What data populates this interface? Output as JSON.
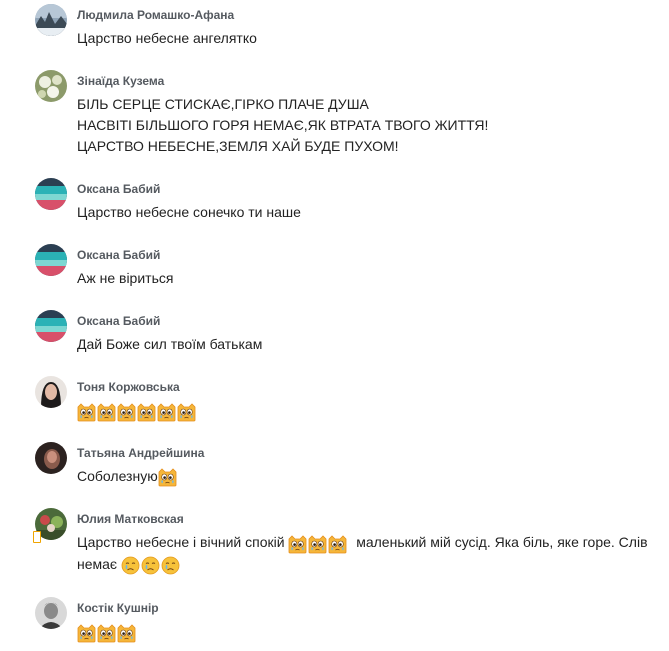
{
  "comments": [
    {
      "author": "Людмила Ромашко-Афана",
      "avatar_icon": "winter-landscape-avatar",
      "lines": [
        "Царство небесне ангелятко"
      ]
    },
    {
      "author": "Зінаїда Кузема",
      "avatar_icon": "flowers-avatar",
      "lines": [
        "БІЛЬ СЕРЦЕ СТИСКАЄ,ГІРКО ПЛАЧЕ ДУША",
        "НАСВІТІ БІЛЬШОГО ГОРЯ НЕМАЄ,ЯК ВТРАТА ТВОГО ЖИТТЯ!",
        "ЦАРСТВО НЕБЕСНЕ,ЗЕМЛЯ ХАЙ БУДЕ ПУХОМ!"
      ]
    },
    {
      "author": "Оксана Бабий",
      "avatar_icon": "sea-sunset-avatar",
      "lines": [
        "Царство небесне сонечко ти наше"
      ]
    },
    {
      "author": "Оксана Бабий",
      "avatar_icon": "sea-sunset-avatar",
      "lines": [
        "Аж не віриться"
      ]
    },
    {
      "author": "Оксана Бабий",
      "avatar_icon": "sea-sunset-avatar",
      "lines": [
        "Дай Боже сил твоїм батькам"
      ]
    },
    {
      "author": "Тоня Коржовська",
      "avatar_icon": "portrait-avatar",
      "emoji": "crying-cat-emoji",
      "emoji_count": 6
    },
    {
      "author": "Татьяна Андрейшина",
      "avatar_icon": "dark-portrait-avatar",
      "text_before_emoji": "Соболезную",
      "emoji": "crying-cat-emoji",
      "emoji_count": 1
    },
    {
      "author": "Юлия Матковская",
      "avatar_icon": "garden-avatar",
      "line1_start": "Царство небесне і вічний спокій",
      "line1_end": "маленький мій сусід. Яка біль, яке горе.  Слів",
      "line1_emoji_count": 3,
      "line2_start": "немає",
      "line2_emoji_count": 3,
      "line2_emoji": "crying-face-emoji",
      "mobile_icon": "mobile-phone-icon"
    },
    {
      "author": "Костік Кушнір",
      "avatar_icon": "bw-portrait-avatar",
      "emoji": "crying-cat-emoji",
      "emoji_count": 3
    }
  ],
  "colors": {
    "author": "#555a60",
    "text": "#222222",
    "emoji_yellow": "#f7c23a",
    "emoji_orange": "#f09a20",
    "tear_blue": "#6cb8e8"
  }
}
